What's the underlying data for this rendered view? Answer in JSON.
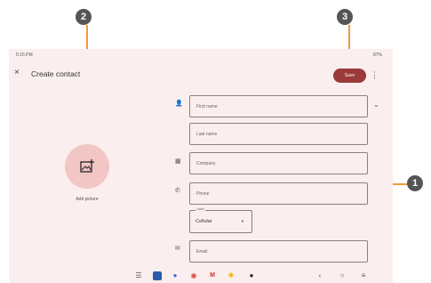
{
  "status_bar": {
    "time": "5:16 PM",
    "right": "87%"
  },
  "app_bar": {
    "close_glyph": "×",
    "title": "Create contact",
    "save_label": "Save",
    "more_glyph": "⋮"
  },
  "avatar": {
    "label": "Add picture"
  },
  "fields": {
    "first_name": "First name",
    "last_name": "Last name",
    "company": "Company",
    "phone": "Phone",
    "phone_type_label": "Label",
    "phone_type_value": "Cellular",
    "email": "Email"
  },
  "callouts": [
    "1",
    "2",
    "3"
  ],
  "icons": {
    "person": "person-icon",
    "company": "company-icon",
    "phone": "phone-icon",
    "email": "email-icon",
    "expand": "expand-icon",
    "add_photo": "add-photo-icon"
  },
  "colors": {
    "accent": "#9b3a3a",
    "callout": "#f29a3a",
    "avatar_bg": "#f2c6c4",
    "background": "#fbeeee"
  }
}
